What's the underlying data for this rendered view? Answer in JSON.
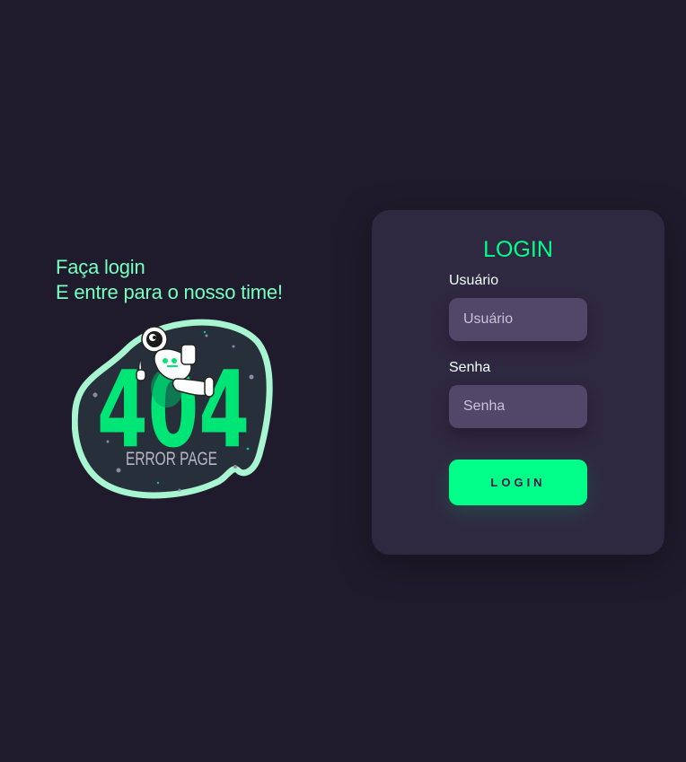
{
  "intro": {
    "line1": "Faça login",
    "line2": "E entre para o nosso time!"
  },
  "illustration": {
    "number": "404",
    "caption": "ERROR PAGE",
    "icon": "astronaut-icon"
  },
  "login_card": {
    "title": "LOGIN",
    "username": {
      "label": "Usuário",
      "placeholder": "Usuário",
      "value": ""
    },
    "password": {
      "label": "Senha",
      "placeholder": "Senha",
      "value": ""
    },
    "button_label": "LOGIN"
  },
  "colors": {
    "background": "#201b2c",
    "card": "#2f2841",
    "input": "#514869",
    "accent": "#00ff88",
    "headline": "#77ffc0"
  }
}
